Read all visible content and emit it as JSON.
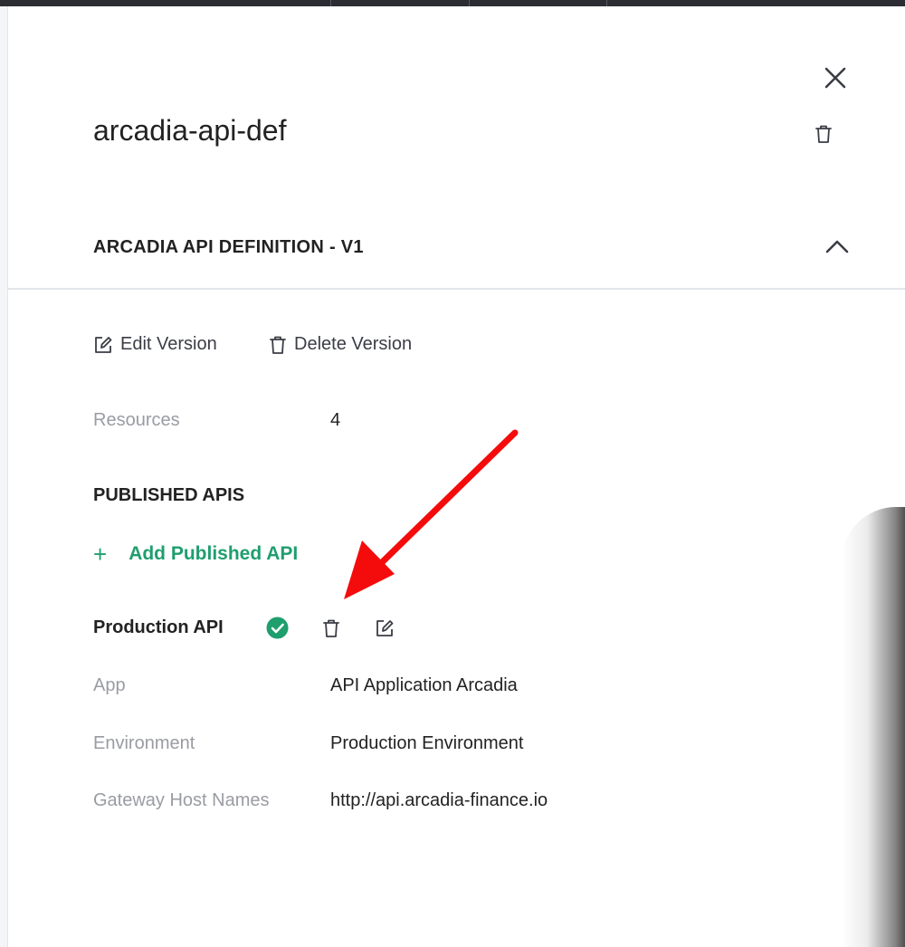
{
  "panel": {
    "title": "arcadia-api-def"
  },
  "version_section": {
    "title": "ARCADIA API DEFINITION - V1",
    "edit_label": "Edit Version",
    "delete_label": "Delete Version",
    "resources_label": "Resources",
    "resources_value": "4"
  },
  "published": {
    "heading": "PUBLISHED APIS",
    "add_label": "Add Published API",
    "add_icon": "+",
    "api": {
      "name": "Production API",
      "status": "active",
      "status_color": "#1f9e6e",
      "fields": [
        {
          "label": "App",
          "value": "API Application Arcadia"
        },
        {
          "label": "Environment",
          "value": "Production Environment"
        },
        {
          "label": "Gateway Host Names",
          "value": "http://api.arcadia-finance.io"
        }
      ]
    }
  },
  "colors": {
    "accent": "#1f9e6e",
    "annotation_arrow": "#f40c0c"
  }
}
